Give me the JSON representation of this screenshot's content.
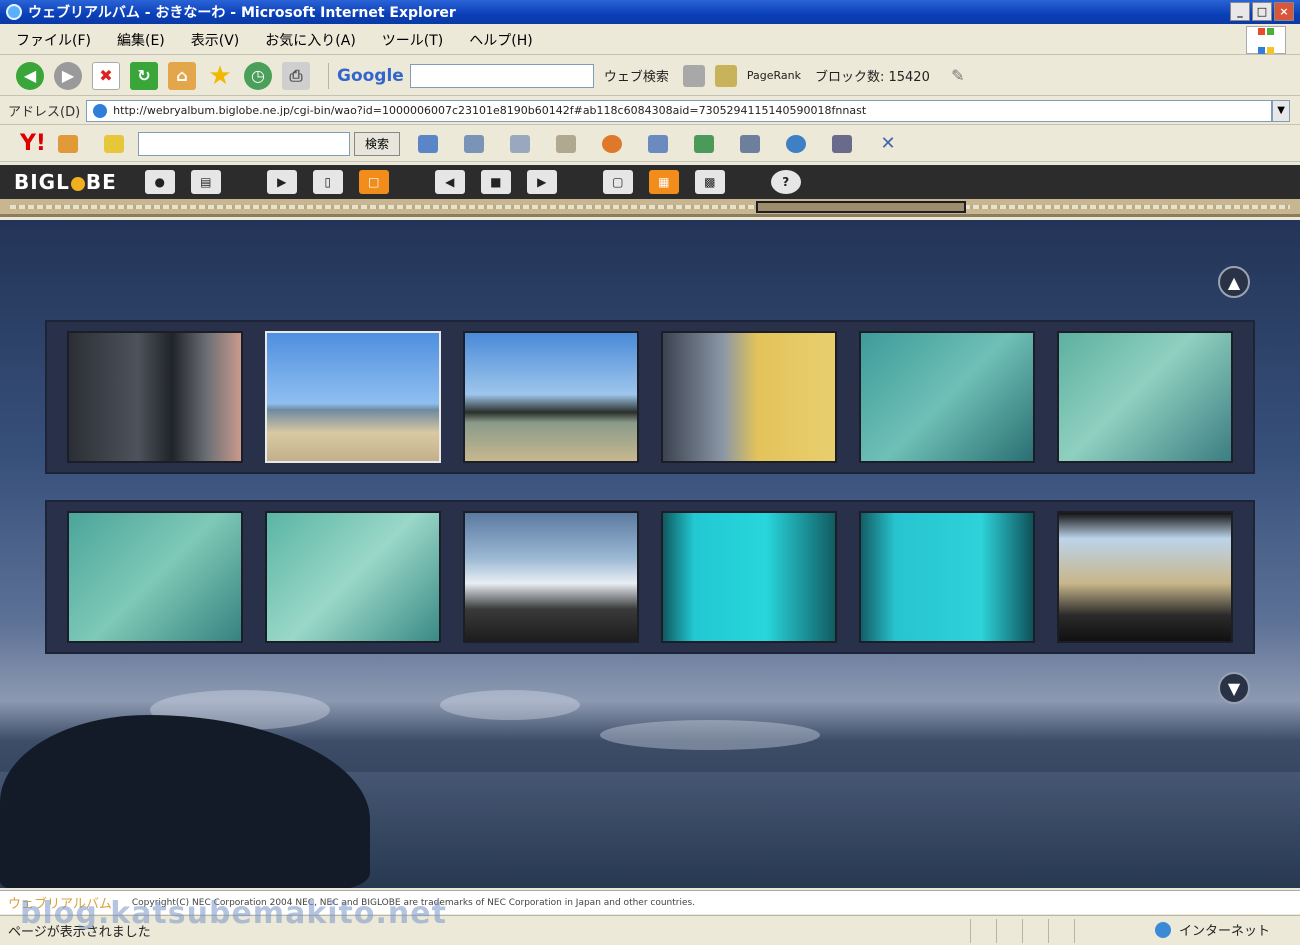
{
  "window": {
    "title": "ウェブリアルバム - おきなーわ - Microsoft Internet Explorer",
    "controls": [
      "_",
      "□",
      "×"
    ]
  },
  "menu": [
    "ファイル(F)",
    "編集(E)",
    "表示(V)",
    "お気に入り(A)",
    "ツール(T)",
    "ヘルプ(H)"
  ],
  "toolbar": {
    "search_engine": "Google",
    "web_search": "ウェブ検索",
    "pagerank": "PageRank",
    "blocked": "ブロック数: 15420"
  },
  "address": {
    "label": "アドレス(D)",
    "url": "http://webryalbum.biglobe.ne.jp/cgi-bin/wao?id=1000006007c23101e8190b60142f#ab118c6084308aid=7305294115140590018fnnast"
  },
  "yahoo": {
    "logo": "Y!",
    "search_label": "検索"
  },
  "album_toolbar": {
    "logo_left": "BIGL",
    "logo_right": "BE",
    "help": "?"
  },
  "gallery": {
    "selected_index": 1,
    "rows": [
      [
        "phone keypad",
        "beach under blue sky",
        "rocky shoreline",
        "pier with boat",
        "sea floor through glass",
        "sea floor through glass"
      ],
      [
        "sea floor through glass",
        "sea floor through glass",
        "boat wake",
        "fish through glass bottom",
        "fish through glass bottom",
        "beach from boat"
      ]
    ]
  },
  "footer": {
    "brand": "ウェブリアルバム",
    "copyright": "Copyright(C) NEC Corporation 2004 NEC, NEC and BIGLOBE are trademarks of NEC Corporation in Japan and other countries."
  },
  "status": {
    "text": "ページが表示されました",
    "zone": "インターネット"
  },
  "watermark": "blog.katsubemakito.net"
}
